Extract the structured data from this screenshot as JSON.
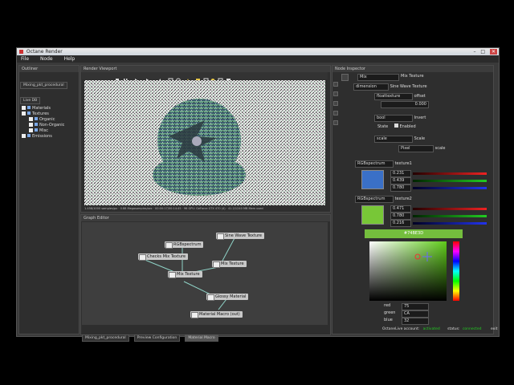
{
  "window": {
    "title": "Octane Render",
    "buttons": [
      "–",
      "□",
      "✕"
    ]
  },
  "menu": [
    "File",
    "Node",
    "Help"
  ],
  "outliner": {
    "title": "Outliner",
    "tabs": [
      "Mixing_pkt_procedural",
      "Live DB"
    ],
    "items": [
      {
        "label": "Materials"
      },
      {
        "label": "Textures"
      },
      {
        "label": "Organic"
      },
      {
        "label": "Non-Organic"
      },
      {
        "label": "Misc"
      },
      {
        "label": "Emissions"
      }
    ]
  },
  "viewport": {
    "title": "Render Viewport",
    "status": "1.458/1000 samples/px · 0.88 Megasamples/sec · 00:00:17/00:14:45 · 96 GPU: GeForce GTX 470 (4) · 41.2/1240 MB Mem used"
  },
  "graph": {
    "title": "Graph Editor",
    "nodes": {
      "rgb": "RGBspectrum",
      "sine": "Sine Wave Texture",
      "checks": "Checks Mix Texture",
      "mix_right": "Mix Texture",
      "mix_center": "Mix Texture",
      "glossy": "Glossy Material",
      "macro": "Material Macro (out)"
    },
    "tabs": [
      "Mixing_pkt_procedural",
      "Preview Configuration",
      "Material Macro"
    ]
  },
  "inspector": {
    "title": "Node Inspector",
    "selector": "Mix",
    "node_label": "Mix Texture",
    "rows": {
      "dimension": "dimension",
      "sine_label": "Sine Wave Texture",
      "float_type": "floattexture",
      "offset": "offset",
      "offset_value": "0.000",
      "bool_type": "bool",
      "invert": "Invert",
      "state": "State",
      "enabled": "Enabled",
      "scale_type": "scale",
      "scale": "Scale",
      "pixel": "Pixel",
      "scale2": "scale",
      "rgb1_type": "RGBspectrum",
      "texture1": "texture1",
      "rgb2_type": "RGBspectrum",
      "texture2": "texture2"
    },
    "texture1": {
      "r": "0.231",
      "g": "0.439",
      "b": "0.780",
      "color": "#3a70c7"
    },
    "texture2": {
      "r": "0.471",
      "g": "0.780",
      "b": "0.216",
      "color": "#78c737"
    },
    "picker": {
      "hex": "#74BE3D",
      "red_label": "red",
      "green_label": "green",
      "blue_label": "blue",
      "red": "75",
      "green": "CA",
      "blue": "32"
    },
    "footer": {
      "account_label": "OctaneLive account:",
      "account_value": "activated",
      "status_label": "status:",
      "status_value": "connected",
      "exit": "exit"
    }
  },
  "colors": {
    "accent_green": "#74be3d",
    "status_green": "#22cc22",
    "panel_bg": "#2e2e2e"
  }
}
